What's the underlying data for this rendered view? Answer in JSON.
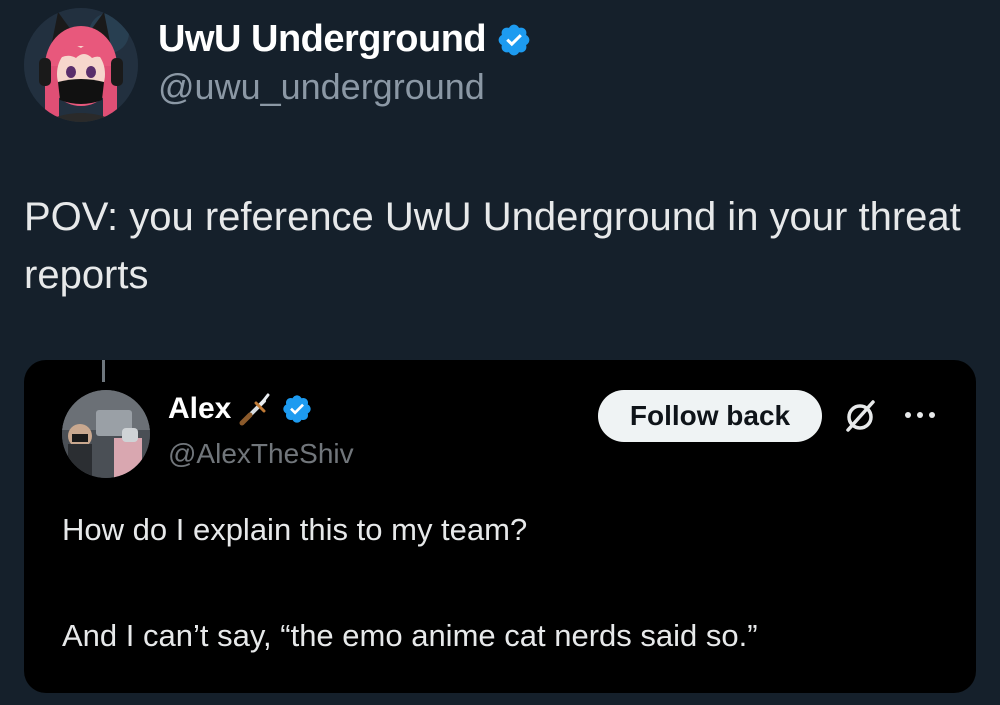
{
  "author": {
    "display_name": "UwU Underground",
    "handle": "@uwu_underground",
    "verified": true,
    "avatar_icon": "anime-cat-ear-girl-avatar"
  },
  "tweet": {
    "text": "POV: you reference UwU Underground in your threat reports"
  },
  "quoted": {
    "display_name": "Alex",
    "name_emoji_icon": "dagger-icon",
    "handle": "@AlexTheShiv",
    "verified": true,
    "avatar_icon": "photo-avatar",
    "follow_button_label": "Follow back",
    "line1": "How do I explain this to my team?",
    "line2": "And I can’t say, “the emo anime cat nerds said so.”"
  },
  "colors": {
    "background": "#15202b",
    "embed_background": "#000000",
    "verified_blue": "#1d9bf0",
    "secondary_text": "#8b98a5"
  }
}
